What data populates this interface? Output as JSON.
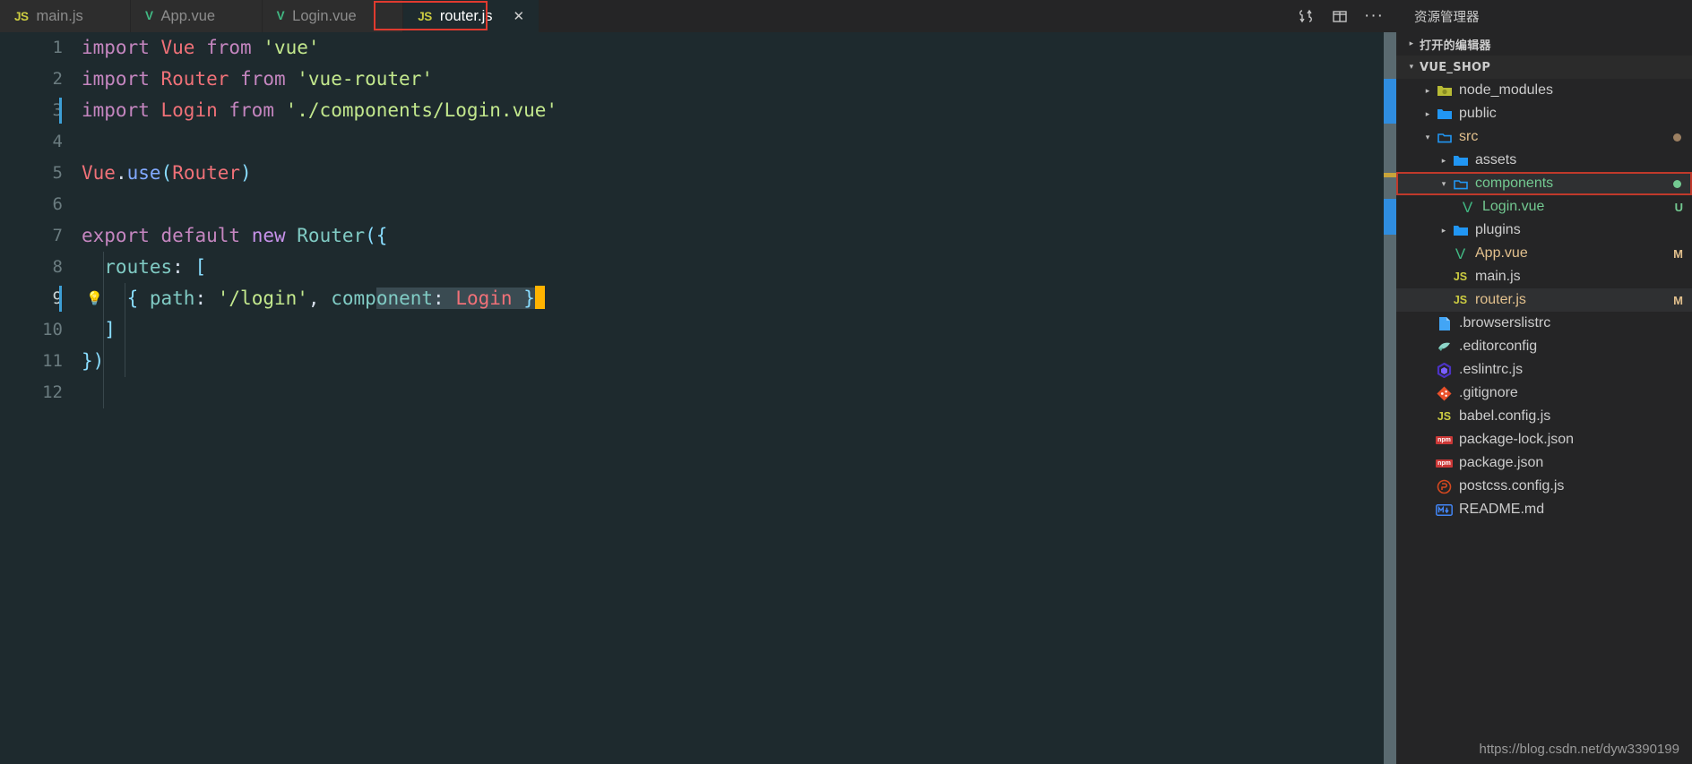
{
  "window": {
    "explorer_title": "资源管理器",
    "watermark": "https://blog.csdn.net/dyw3390199"
  },
  "tabs": [
    {
      "label": "main.js",
      "icon": "js-file-icon",
      "active": false
    },
    {
      "label": "App.vue",
      "icon": "vue-file-icon",
      "active": false
    },
    {
      "label": "Login.vue",
      "icon": "vue-file-icon",
      "active": false
    },
    {
      "label": "router.js",
      "icon": "js-file-icon",
      "active": true,
      "close": "✕"
    }
  ],
  "editor_actions": [
    {
      "name": "split-diff-icon",
      "label": "⇅"
    },
    {
      "name": "split-editor-icon",
      "label": "▭"
    },
    {
      "name": "more-actions-icon",
      "label": "···"
    }
  ],
  "editor": {
    "filename": "router.js",
    "language": "javascript",
    "cursor_line": 9,
    "total_lines": 12,
    "selection_text": "onent: Login }",
    "lines": [
      {
        "n": "1",
        "text": "import Vue from 'vue'"
      },
      {
        "n": "2",
        "text": "import Router from 'vue-router'"
      },
      {
        "n": "3",
        "text": "import Login from './components/Login.vue'"
      },
      {
        "n": "4",
        "text": ""
      },
      {
        "n": "5",
        "text": "Vue.use(Router)"
      },
      {
        "n": "6",
        "text": ""
      },
      {
        "n": "7",
        "text": "export default new Router({"
      },
      {
        "n": "8",
        "text": "  routes: ["
      },
      {
        "n": "9",
        "text": "    { path: '/login', component: Login }"
      },
      {
        "n": "10",
        "text": "  ]"
      },
      {
        "n": "11",
        "text": "})"
      },
      {
        "n": "12",
        "text": ""
      }
    ],
    "quickfix_hint": "lightbulb"
  },
  "sidebar": {
    "sections": [
      {
        "label": "打开的编辑器",
        "expanded": false
      },
      {
        "label": "VUE_SHOP",
        "expanded": true
      }
    ],
    "tree": [
      {
        "name": "node_modules",
        "type": "folder",
        "icon": "folder-node-icon",
        "indent": 1,
        "expanded": false,
        "color": "plain",
        "badge": ""
      },
      {
        "name": "public",
        "type": "folder",
        "icon": "folder-icon",
        "indent": 1,
        "expanded": false,
        "color": "plain",
        "badge": ""
      },
      {
        "name": "src",
        "type": "folder",
        "icon": "folder-open-icon",
        "indent": 1,
        "expanded": true,
        "color": "orange",
        "badge": "dot-orange"
      },
      {
        "name": "assets",
        "type": "folder",
        "icon": "folder-icon",
        "indent": 2,
        "expanded": false,
        "color": "plain",
        "badge": ""
      },
      {
        "name": "components",
        "type": "folder",
        "icon": "folder-open-icon",
        "indent": 2,
        "expanded": true,
        "color": "green",
        "badge": "dot-green",
        "selected": true,
        "highlighted": true
      },
      {
        "name": "Login.vue",
        "type": "file",
        "icon": "vue-file-icon",
        "indent": 3,
        "color": "green",
        "badge": "U"
      },
      {
        "name": "plugins",
        "type": "folder",
        "icon": "folder-icon",
        "indent": 2,
        "expanded": false,
        "color": "plain",
        "badge": ""
      },
      {
        "name": "App.vue",
        "type": "file",
        "icon": "vue-file-icon",
        "indent": 2,
        "color": "orange",
        "badge": "M"
      },
      {
        "name": "main.js",
        "type": "file",
        "icon": "js-file-icon",
        "indent": 2,
        "color": "plain",
        "badge": ""
      },
      {
        "name": "router.js",
        "type": "file",
        "icon": "js-file-icon",
        "indent": 2,
        "color": "orange",
        "badge": "M",
        "selected": true
      },
      {
        "name": ".browserslistrc",
        "type": "file",
        "icon": "text-file-icon",
        "indent": 1,
        "color": "plain",
        "badge": ""
      },
      {
        "name": ".editorconfig",
        "type": "file",
        "icon": "editorconfig-icon",
        "indent": 1,
        "color": "plain",
        "badge": ""
      },
      {
        "name": ".eslintrc.js",
        "type": "file",
        "icon": "eslint-icon",
        "indent": 1,
        "color": "plain",
        "badge": ""
      },
      {
        "name": ".gitignore",
        "type": "file",
        "icon": "git-icon",
        "indent": 1,
        "color": "plain",
        "badge": ""
      },
      {
        "name": "babel.config.js",
        "type": "file",
        "icon": "js-file-icon",
        "indent": 1,
        "color": "plain",
        "badge": ""
      },
      {
        "name": "package-lock.json",
        "type": "file",
        "icon": "npm-icon",
        "indent": 1,
        "color": "plain",
        "badge": ""
      },
      {
        "name": "package.json",
        "type": "file",
        "icon": "npm-icon",
        "indent": 1,
        "color": "plain",
        "badge": ""
      },
      {
        "name": "postcss.config.js",
        "type": "file",
        "icon": "postcss-icon",
        "indent": 1,
        "color": "plain",
        "badge": ""
      },
      {
        "name": "README.md",
        "type": "file",
        "icon": "markdown-icon",
        "indent": 1,
        "color": "plain",
        "badge": ""
      }
    ]
  },
  "colors": {
    "editor_bg": "#1e2a2e",
    "sidebar_bg": "#252526",
    "tab_active_bg": "#1e2a2e",
    "accent_red": "#e03a2f",
    "cursor": "#ffb300",
    "selection": "#3a4b52",
    "string": "#c3e88d",
    "keyword": "#c586c0",
    "identifier": "#f07178",
    "punctuation": "#89ddff",
    "property": "#80cbc4"
  }
}
